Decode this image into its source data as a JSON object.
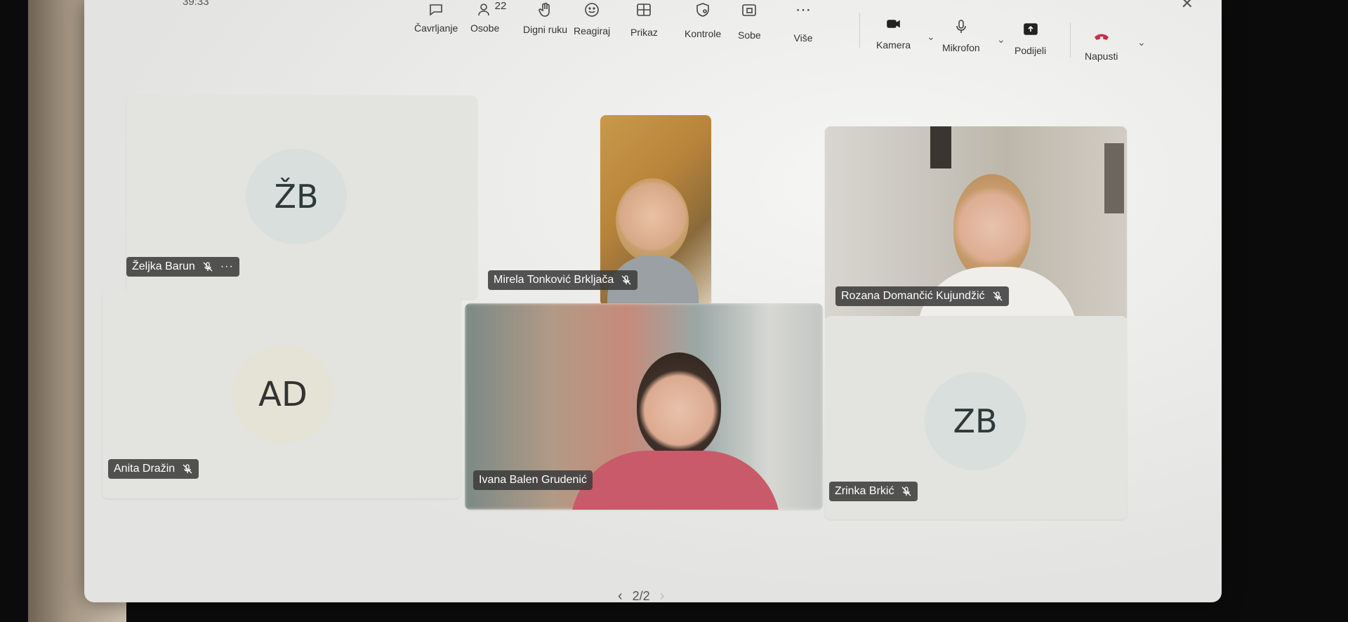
{
  "toolbar": {
    "timer": "39:33",
    "items": [
      {
        "label": "Čavrljanje",
        "icon": "chat-icon"
      },
      {
        "label": "Osobe",
        "icon": "people-icon",
        "count": "22"
      },
      {
        "label": "Digni ruku",
        "icon": "raise-hand-icon"
      },
      {
        "label": "Reagiraj",
        "icon": "react-icon"
      },
      {
        "label": "Prikaz",
        "icon": "view-icon"
      },
      {
        "label": "Kontrole",
        "icon": "controls-icon"
      },
      {
        "label": "Sobe",
        "icon": "rooms-icon"
      },
      {
        "label": "Više",
        "icon": "more-icon"
      },
      {
        "label": "Kamera",
        "icon": "camera-icon"
      },
      {
        "label": "Mikrofon",
        "icon": "microphone-icon"
      },
      {
        "label": "Podijeli",
        "icon": "share-icon"
      },
      {
        "label": "Napusti",
        "icon": "leave-icon"
      }
    ]
  },
  "participants": [
    {
      "name": "Željka Barun",
      "initials": "ŽB",
      "muted": true,
      "has_more": true,
      "video": false
    },
    {
      "name": "Mirela Tonković Brkljača",
      "muted": true,
      "video": true
    },
    {
      "name": "Rozana Domančić Kujundžić",
      "muted": true,
      "video": true
    },
    {
      "name": "Anita Dražin",
      "initials": "AD",
      "muted": true,
      "video": false
    },
    {
      "name": "Ivana Balen Grudenić",
      "muted": false,
      "video": true
    },
    {
      "name": "Zrinka Brkić",
      "initials": "ZB",
      "muted": true,
      "video": false
    }
  ],
  "pager": {
    "label": "2/2"
  },
  "colors": {
    "accent_leave": "#c4314b",
    "name_tag_bg": "#3c3c3c",
    "avatar_bg": "#d9dfdd"
  }
}
